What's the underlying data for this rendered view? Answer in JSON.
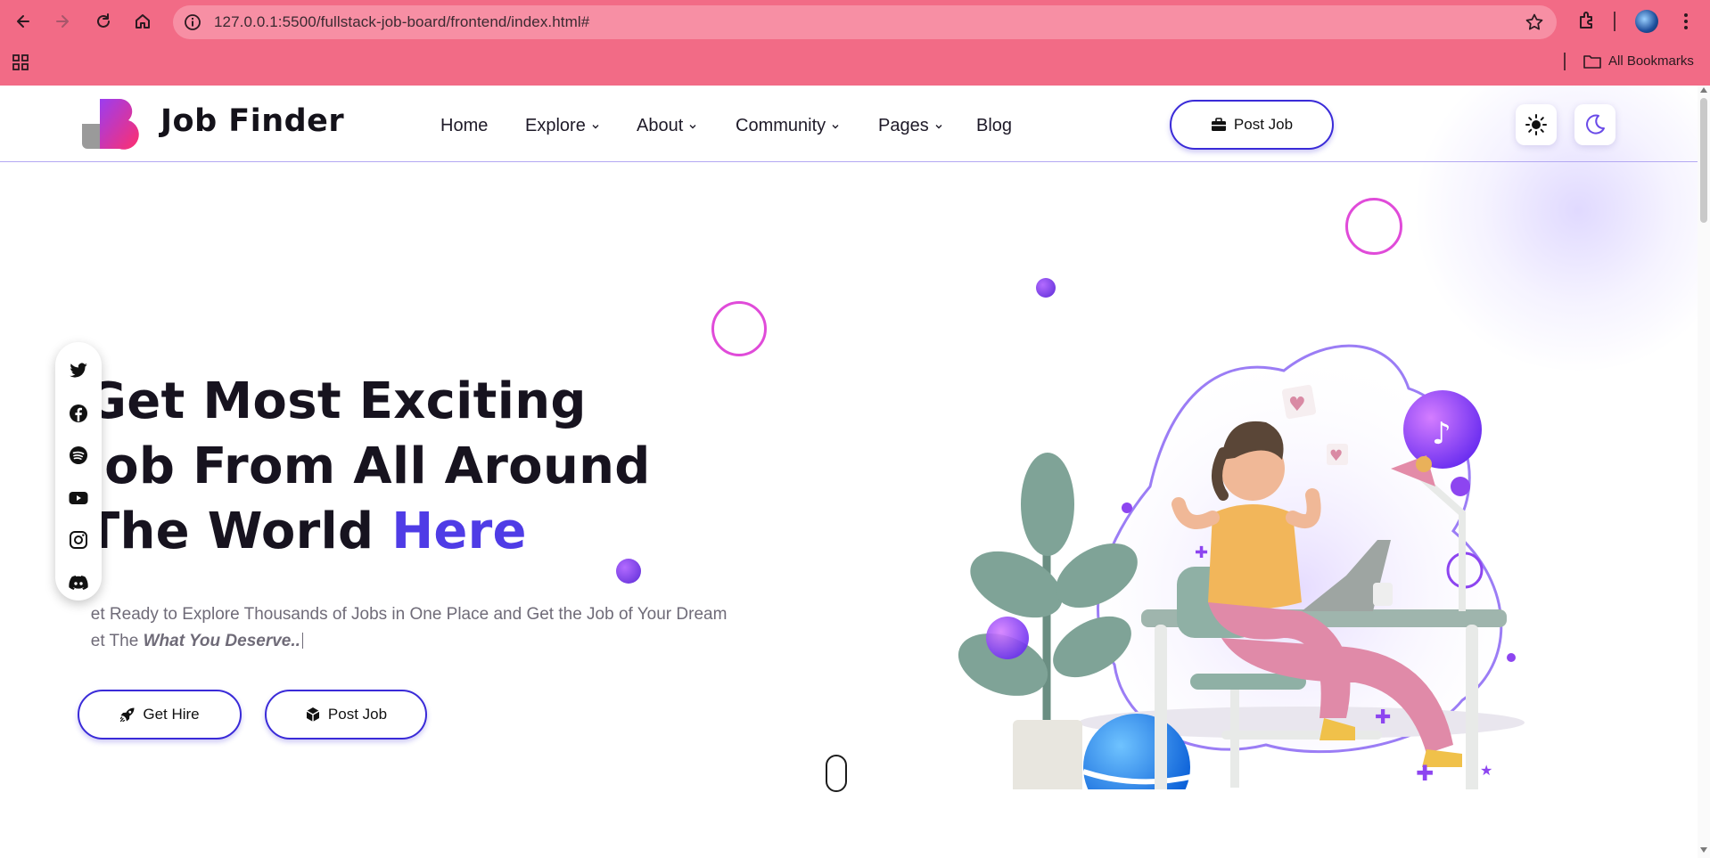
{
  "browser": {
    "url": "127.0.0.1:5500/fullstack-job-board/frontend/index.html#",
    "bookmarks_label": "All Bookmarks"
  },
  "header": {
    "logo_text": "Job Finder",
    "nav": [
      {
        "label": "Home",
        "has_dropdown": false
      },
      {
        "label": "Explore",
        "has_dropdown": true
      },
      {
        "label": "About",
        "has_dropdown": true
      },
      {
        "label": "Community",
        "has_dropdown": true
      },
      {
        "label": "Pages",
        "has_dropdown": true
      },
      {
        "label": "Blog",
        "has_dropdown": false
      }
    ],
    "post_job_label": "Post Job"
  },
  "social": [
    "twitter-icon",
    "facebook-icon",
    "spotify-icon",
    "youtube-icon",
    "instagram-icon",
    "discord-icon"
  ],
  "hero": {
    "title_line1": "Get Most Exciting",
    "title_line2": "Job From All Around",
    "title_line3_prefix": "The World ",
    "title_line3_accent": "Here",
    "subtitle_line1": "Get Ready to Explore Thousands of Jobs in One Place and Get the Job of Your Dream",
    "subtitle_line2_prefix": "Get The ",
    "subtitle_line2_emphasis": "What You Deserve..",
    "get_hire_label": "Get Hire",
    "post_job_label": "Post Job"
  },
  "colors": {
    "accent": "#4f3ce6",
    "button_border": "#3a2bd8",
    "chrome": "#f26b86"
  }
}
